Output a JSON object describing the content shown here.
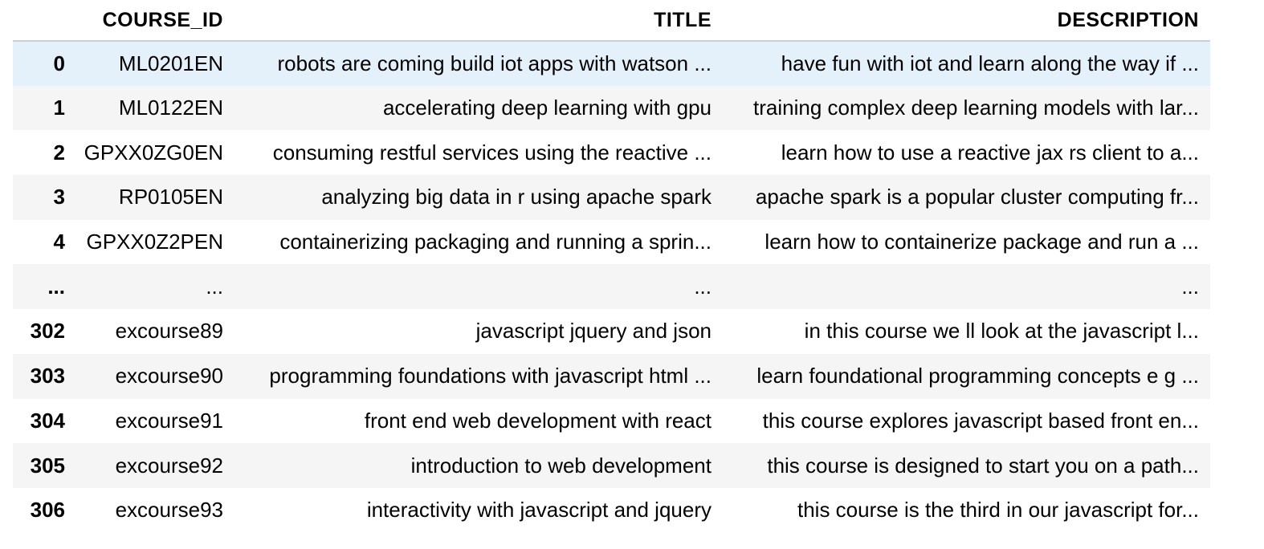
{
  "table": {
    "columns": [
      "",
      "COURSE_ID",
      "TITLE",
      "DESCRIPTION"
    ],
    "rows": [
      {
        "index": "0",
        "course_id": "ML0201EN",
        "title": "robots are coming build iot apps with watson ...",
        "description": "have fun with iot and learn along the way if ..."
      },
      {
        "index": "1",
        "course_id": "ML0122EN",
        "title": "accelerating deep learning with gpu",
        "description": "training complex deep learning models with lar..."
      },
      {
        "index": "2",
        "course_id": "GPXX0ZG0EN",
        "title": "consuming restful services using the reactive ...",
        "description": "learn how to use a reactive jax rs client to a..."
      },
      {
        "index": "3",
        "course_id": "RP0105EN",
        "title": "analyzing big data in r using apache spark",
        "description": "apache spark is a popular cluster computing fr..."
      },
      {
        "index": "4",
        "course_id": "GPXX0Z2PEN",
        "title": "containerizing packaging and running a sprin...",
        "description": "learn how to containerize package and run a ..."
      },
      {
        "index": "...",
        "course_id": "...",
        "title": "...",
        "description": "..."
      },
      {
        "index": "302",
        "course_id": "excourse89",
        "title": "javascript jquery and json",
        "description": "in this course we ll look at the javascript l..."
      },
      {
        "index": "303",
        "course_id": "excourse90",
        "title": "programming foundations with javascript html ...",
        "description": "learn foundational programming concepts e g ..."
      },
      {
        "index": "304",
        "course_id": "excourse91",
        "title": "front end web development with react",
        "description": "this course explores javascript based front en..."
      },
      {
        "index": "305",
        "course_id": "excourse92",
        "title": "introduction to web development",
        "description": "this course is designed to start you on a path..."
      },
      {
        "index": "306",
        "course_id": "excourse93",
        "title": "interactivity with javascript and jquery",
        "description": "this course is the third in our javascript for..."
      }
    ]
  },
  "colors": {
    "stripe": "#f5f5f5",
    "hover": "#e4f1fb",
    "header_rule": "#c8d0d8"
  }
}
